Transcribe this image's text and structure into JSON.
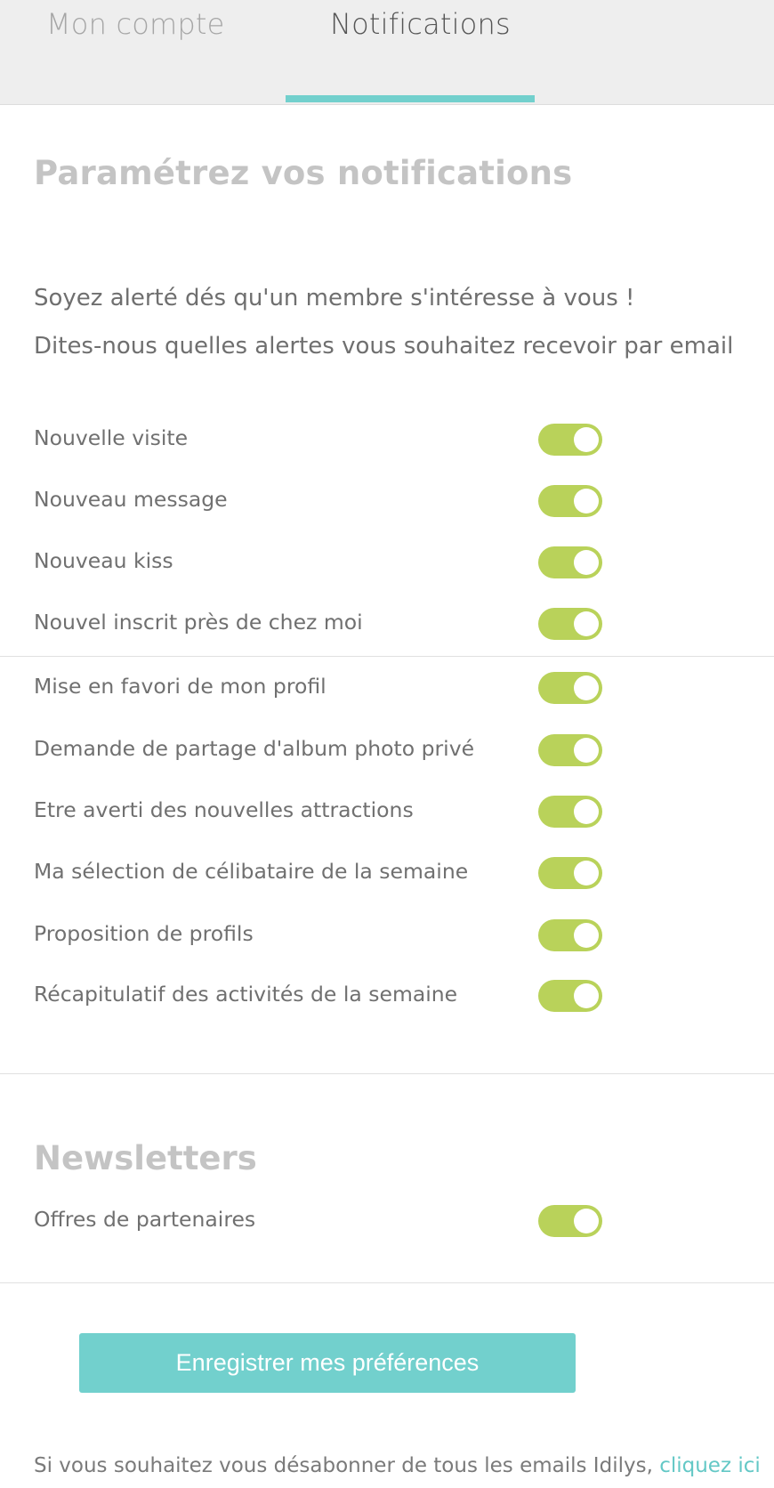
{
  "tabs": {
    "account_label": "Mon compte",
    "notifications_label": "Notifications"
  },
  "notifications": {
    "title": "Paramétrez vos notifications",
    "intro_line1": "Soyez alerté dés qu'un membre s'intéresse à vous !",
    "intro_line2": "Dites-nous quelles alertes vous souhaitez recevoir par email",
    "items": [
      {
        "label": "Nouvelle visite",
        "enabled": true
      },
      {
        "label": "Nouveau message",
        "enabled": true
      },
      {
        "label": "Nouveau kiss",
        "enabled": true
      },
      {
        "label": "Nouvel inscrit près de chez moi",
        "enabled": true
      },
      {
        "label": "Mise en favori de mon profil",
        "enabled": true
      },
      {
        "label": "Demande de partage d'album photo privé",
        "enabled": true
      },
      {
        "label": "Etre averti des nouvelles attractions",
        "enabled": true
      },
      {
        "label": "Ma sélection de célibataire de la semaine",
        "enabled": true
      },
      {
        "label": "Proposition de profils",
        "enabled": true
      },
      {
        "label": "Récapitulatif des activités de la semaine",
        "enabled": true
      }
    ]
  },
  "newsletters": {
    "title": "Newsletters",
    "items": [
      {
        "label": "Offres de partenaires",
        "enabled": true
      }
    ]
  },
  "save_button_label": "Enregistrer mes préférences",
  "footer": {
    "text": "Si vous souhaitez vous désabonner de tous les emails Idilys, ",
    "link_label": "cliquez ici"
  },
  "colors": {
    "accent": "#72d0cd",
    "toggle_on": "#b9d25a",
    "tab_bar_bg": "#eeeeee"
  }
}
